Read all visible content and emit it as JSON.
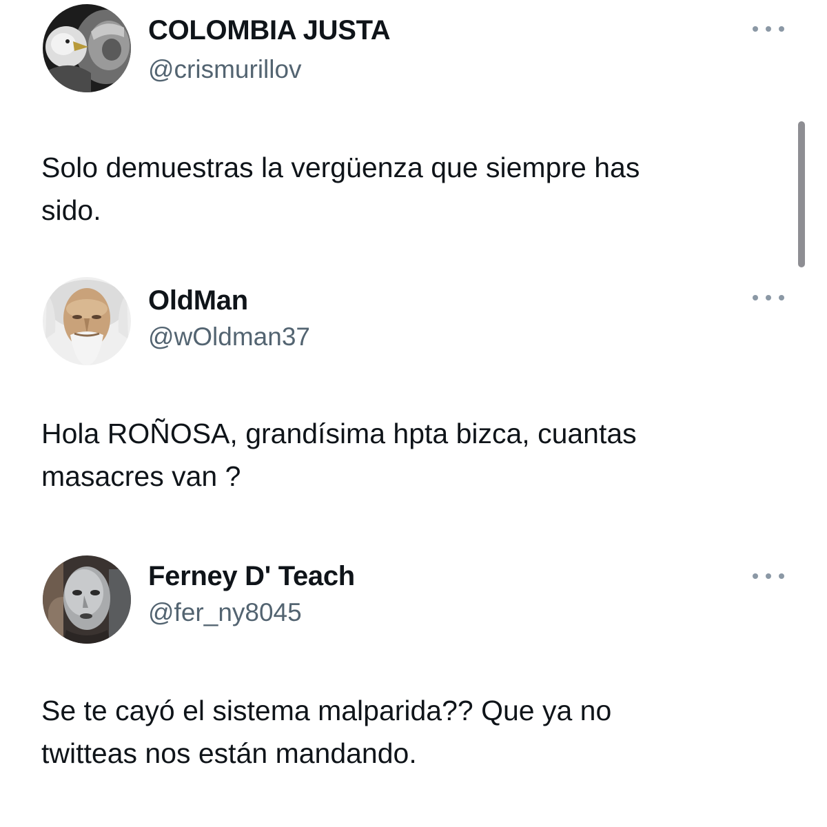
{
  "tweets": [
    {
      "name": "COLOMBIA JUSTA",
      "handle": "@crismurillov",
      "text_lines": [
        "Solo demuestras la vergüenza que siempre has",
        "sido."
      ]
    },
    {
      "name": "OldMan",
      "handle": "@wOldman37",
      "text_lines": [
        "Hola ROÑOSA, grandísima hpta bizca,  cuantas",
        "masacres van ?"
      ]
    },
    {
      "name": "Ferney D' Teach",
      "handle": "@fer_ny8045",
      "text_lines": [
        "Se te cayó el sistema malparida?? Que ya no",
        "twitteas nos están mandando."
      ]
    }
  ],
  "icons": {
    "more": "more-horizontal-icon",
    "avatar_1": "lion-eagle-avatar",
    "avatar_2": "old-man-avatar",
    "avatar_3": "silver-mask-avatar"
  },
  "colors": {
    "text": "#0f1419",
    "secondary": "#536471",
    "dots": "#8b98a5",
    "scrollbar": "#8e8e93"
  }
}
